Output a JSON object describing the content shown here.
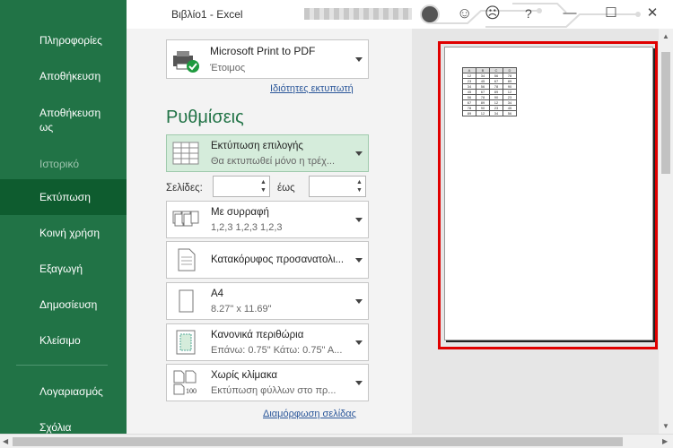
{
  "window": {
    "title": "Βιβλίο1  -  Excel",
    "help": "?",
    "minimize": "—",
    "maximize": "☐",
    "close": "✕"
  },
  "sidebar": {
    "items": [
      {
        "label": "Πληροφορίες"
      },
      {
        "label": "Αποθήκευση"
      },
      {
        "label": "Αποθήκευση ως"
      },
      {
        "label": "Ιστορικό"
      },
      {
        "label": "Εκτύπωση"
      },
      {
        "label": "Κοινή χρήση"
      },
      {
        "label": "Εξαγωγή"
      },
      {
        "label": "Δημοσίευση"
      },
      {
        "label": "Κλείσιμο"
      },
      {
        "label": "Λογαριασμός"
      },
      {
        "label": "Σχόλια"
      }
    ]
  },
  "printer": {
    "name": "Microsoft Print to PDF",
    "status": "Έτοιμος",
    "properties_link": "Ιδιότητες εκτυπωτή"
  },
  "settings": {
    "title": "Ρυθμίσεις",
    "what": {
      "l1": "Εκτύπωση επιλογής",
      "l2": "Θα εκτυπωθεί μόνο η τρέχ..."
    },
    "pages_label": "Σελίδες:",
    "to_label": "έως",
    "pages_from": "",
    "pages_to": "",
    "collate": {
      "l1": "Με συρραφή",
      "l2": "1,2,3    1,2,3    1,2,3"
    },
    "orientation": {
      "l1": "Κατακόρυφος προσανατολι..."
    },
    "paper": {
      "l1": "A4",
      "l2": "8.27\" x 11.69\""
    },
    "margins": {
      "l1": "Κανονικά περιθώρια",
      "l2": "Επάνω: 0.75\" Κάτω: 0.75\" Α..."
    },
    "scaling": {
      "l1": "Χωρίς κλίμακα",
      "l2": "Εκτύπωση φύλλων στο πρ..."
    },
    "page_setup_link": "Διαμόρφωση σελίδας"
  },
  "preview": {
    "table_rows": [
      [
        "A",
        "B",
        "C",
        "D"
      ],
      [
        "12",
        "34",
        "56",
        "78"
      ],
      [
        "23",
        "45",
        "67",
        "89"
      ],
      [
        "34",
        "56",
        "78",
        "90"
      ],
      [
        "45",
        "67",
        "89",
        "12"
      ],
      [
        "56",
        "78",
        "90",
        "23"
      ],
      [
        "67",
        "89",
        "12",
        "34"
      ],
      [
        "78",
        "90",
        "23",
        "45"
      ],
      [
        "89",
        "12",
        "34",
        "56"
      ]
    ]
  },
  "colors": {
    "accent": "#217346",
    "sidebar_active": "#0e5c2f",
    "highlight": "#e00000"
  }
}
